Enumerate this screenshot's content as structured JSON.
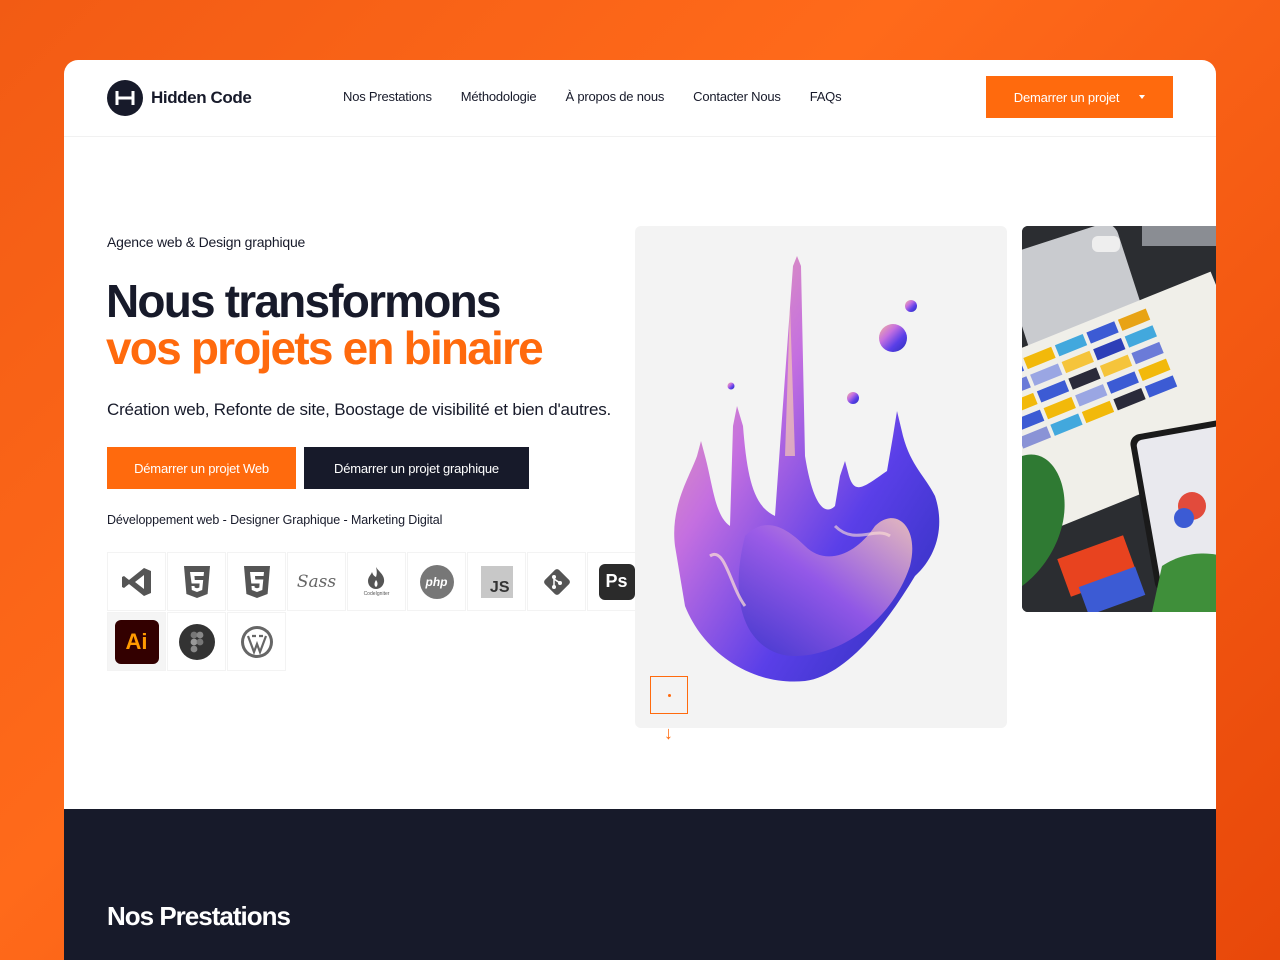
{
  "brand": {
    "name": "Hidden Code"
  },
  "nav": {
    "items": [
      "Nos Prestations",
      "Méthodologie",
      "À propos de nous",
      "Contacter Nous",
      "FAQs"
    ],
    "cta_label": "Demarrer un projet"
  },
  "hero": {
    "eyebrow": "Agence web & Design graphique",
    "title_line1": "Nous transformons",
    "title_line2": "vos projets en binaire",
    "subtitle": "Création web, Refonte de site, Boostage de visibilité et bien d'autres.",
    "btn_web": "Démarrer un projet Web",
    "btn_graphic": "Démarrer un projet graphique",
    "tagline": "Développement web - Designer Graphique - Marketing Digital"
  },
  "tech_icons": [
    "vscode-icon",
    "html5-icon",
    "css3-icon",
    "sass-icon",
    "codeigniter-icon",
    "php-icon",
    "javascript-icon",
    "git-icon",
    "photoshop-icon",
    "illustrator-icon",
    "figma-icon",
    "wordpress-icon"
  ],
  "tech_labels": {
    "sass": "Sass",
    "php": "php",
    "js": "JS",
    "ps": "Ps",
    "ai": "Ai",
    "ci": "CodeIgniter"
  },
  "colors": {
    "accent": "#ff6a0d",
    "dark": "#171a2a",
    "background": "#f25b14"
  },
  "section": {
    "title": "Nos Prestations"
  }
}
